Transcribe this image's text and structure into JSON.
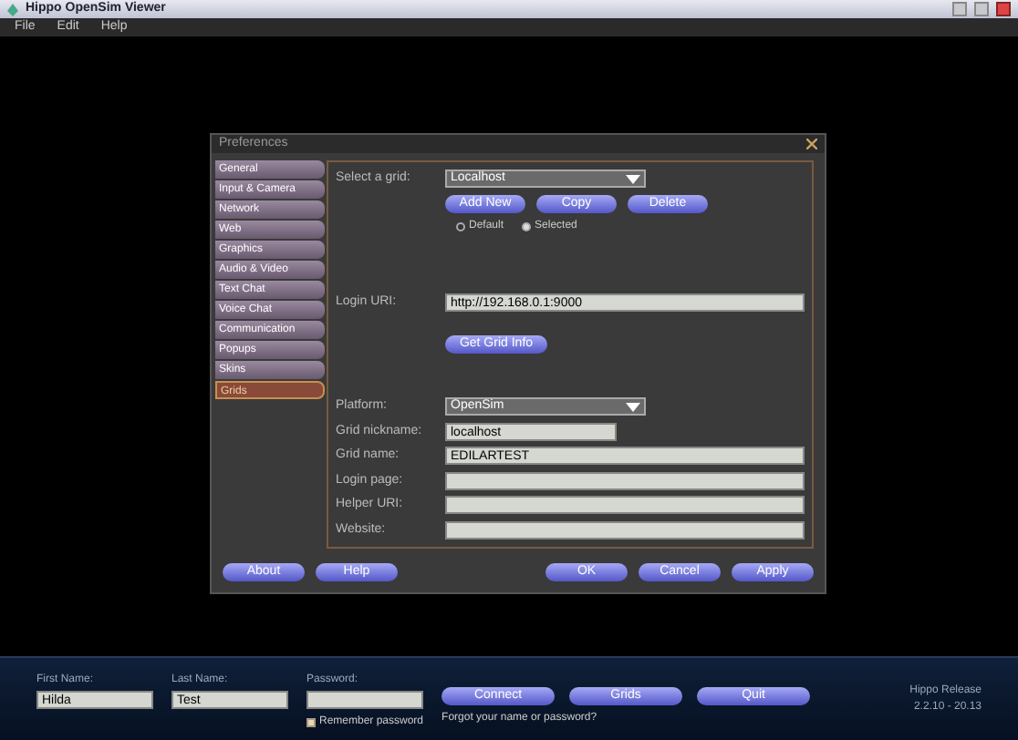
{
  "window": {
    "title": "Hippo OpenSim Viewer"
  },
  "menu": [
    "File",
    "Edit",
    "Help"
  ],
  "dialog": {
    "title": "Preferences",
    "tabs": [
      {
        "label": "General",
        "selected": false
      },
      {
        "label": "Input & Camera",
        "selected": false
      },
      {
        "label": "Network",
        "selected": false
      },
      {
        "label": "Web",
        "selected": false
      },
      {
        "label": "Graphics",
        "selected": false
      },
      {
        "label": "Audio & Video",
        "selected": false
      },
      {
        "label": "Text Chat",
        "selected": false
      },
      {
        "label": "Voice Chat",
        "selected": false
      },
      {
        "label": "Communication",
        "selected": false
      },
      {
        "label": "Popups",
        "selected": false
      },
      {
        "label": "Skins",
        "selected": false
      },
      {
        "label": "Grids",
        "selected": true
      }
    ],
    "grid_select": {
      "label": "Select a grid:",
      "value": "Localhost"
    },
    "grid_buttons": [
      "Add New",
      "Copy",
      "Delete"
    ],
    "grid_radios": [
      {
        "label": "Default",
        "selected": false
      },
      {
        "label": "Selected",
        "selected": true
      }
    ],
    "login_uri": {
      "label": "Login URI:",
      "value": "http://192.168.0.1:9000"
    },
    "info_button": "Get Grid Info",
    "platform": {
      "label": "Platform:",
      "value": "OpenSim"
    },
    "nickname": {
      "label": "Grid nickname:",
      "value": "localhost"
    },
    "fields": [
      {
        "label": "Grid name:",
        "value": "EDILARTEST"
      },
      {
        "label": "Login page:"
      },
      {
        "label": "Helper URI:"
      },
      {
        "label": "Website:"
      }
    ],
    "left_buttons": [
      "About",
      "Help"
    ],
    "right_buttons": [
      "OK",
      "Cancel",
      "Apply"
    ]
  },
  "login": {
    "first": {
      "label": "First Name:",
      "value": "Hilda"
    },
    "last": {
      "label": "Last Name:",
      "value": "Test"
    },
    "password": {
      "label": "Password:"
    },
    "remember": {
      "label": "Remember password",
      "checked": false
    },
    "buttons": [
      "Connect",
      "Grids",
      "Quit"
    ],
    "forgot": "Forgot your name or password?",
    "version": [
      "Hippo Release",
      "2.2.10 - 20.13"
    ]
  }
}
